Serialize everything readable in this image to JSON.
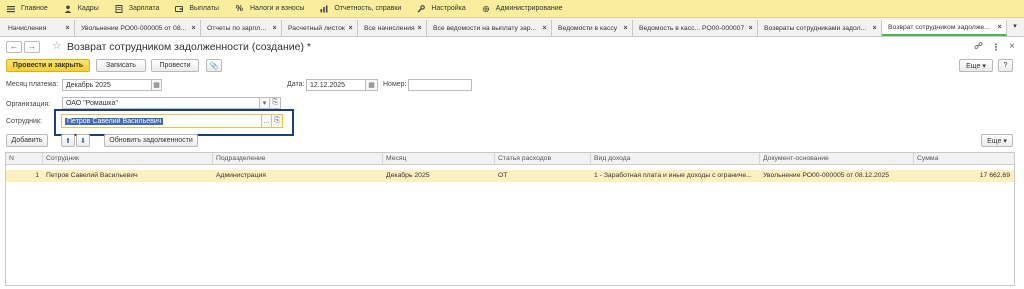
{
  "menu": [
    {
      "label": "Главное",
      "icon": "hamburger-icon"
    },
    {
      "label": "Кадры",
      "icon": "person-icon"
    },
    {
      "label": "Зарплата",
      "icon": "document-icon"
    },
    {
      "label": "Выплаты",
      "icon": "wallet-icon"
    },
    {
      "label": "Налоги и взносы",
      "icon": "percent-icon"
    },
    {
      "label": "Отчетность, справки",
      "icon": "chart-icon"
    },
    {
      "label": "Настройка",
      "icon": "wrench-icon"
    },
    {
      "label": "Администрирование",
      "icon": "gear-icon"
    }
  ],
  "tabs": [
    {
      "label": "Начисления"
    },
    {
      "label": "Увольнение РО00-000005 от 08..."
    },
    {
      "label": "Отчеты по зарплате"
    },
    {
      "label": "Расчетный листок"
    },
    {
      "label": "Все начисления"
    },
    {
      "label": "Все ведомости на выплату зар..."
    },
    {
      "label": "Ведомости в кассу"
    },
    {
      "label": "Ведомость в касс... РО00-000007"
    },
    {
      "label": "Возвраты сотрудниками задол..."
    },
    {
      "label": "Возврат сотрудником задолже..."
    }
  ],
  "header": {
    "back": "←",
    "forward": "→",
    "star": "☆",
    "title": "Возврат сотрудником задолженности (создание) *",
    "link_icon": "🔗",
    "more_icon": "⋮",
    "close_icon": "×"
  },
  "toolbar": {
    "post_close": "Провести и закрыть",
    "save": "Записать",
    "post": "Провести",
    "attach_icon": "📎",
    "more": "Еще ▾",
    "help": "?"
  },
  "fields": {
    "month_label": "Месяц платежа:",
    "month_value": "Декабрь 2025",
    "date_label": "Дата:",
    "date_value": "12.12.2025",
    "number_label": "Номер:",
    "number_value": "",
    "org_label": "Организация:",
    "org_value": "ОАО \"Ромашка\"",
    "employee_label": "Сотрудник:",
    "employee_value": "Петров Савелий Васильевич"
  },
  "table_toolbar": {
    "add": "Добавить",
    "up_icon": "⬆",
    "down_icon": "⬇",
    "refresh": "Обновить задолженности",
    "more": "Еще ▾"
  },
  "table": {
    "columns": [
      "N",
      "Сотрудник",
      "Подразделение",
      "Месяц",
      "Статья расходов",
      "Вид дохода",
      "Документ-основание",
      "Сумма"
    ],
    "rows": [
      [
        "1",
        "Петров Савелий Васильевич",
        "Администрация",
        "Декабрь 2025",
        "ОТ",
        "1 - Заработная плата и иные доходы с ограниче...",
        "Увольнение РО00-000005 от 08.12.2025",
        "17 662,69"
      ]
    ]
  },
  "colors": {
    "menu_bg": "#fbed9e",
    "primary_button": "#f4d031",
    "selected_row": "#fbf1bf",
    "active_tab_underline": "#48b559",
    "highlight_frame": "#1b3f7a"
  }
}
